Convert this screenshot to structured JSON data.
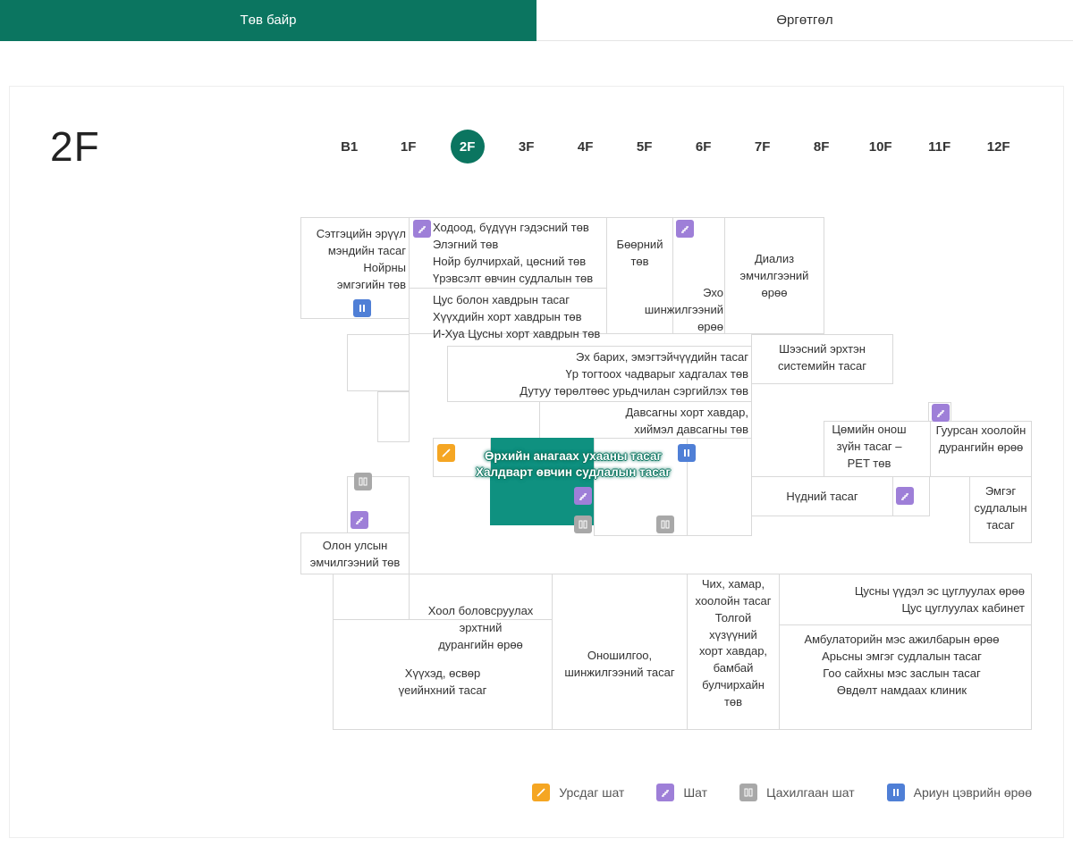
{
  "tabs": {
    "main": "Төв байр",
    "ext": "Өргөтгөл"
  },
  "currentFloorTitle": "2F",
  "floors": [
    "B1",
    "1F",
    "2F",
    "3F",
    "4F",
    "5F",
    "6F",
    "7F",
    "8F",
    "10F",
    "11F",
    "12F"
  ],
  "activeFloor": "2F",
  "rooms": {
    "mental": "Сэтгэцийн эрүүл\nмэндийн тасаг\nНойрны\nэмгэгийн  төв",
    "gi": "Ходоод, бүдүүн гэдэсний төв\nЭлэгний төв\nНойр булчирхай, цөсний төв\nҮрэвсэлт өвчин судлалын төв",
    "blood": "Цус болон хавдрын тасаг\nХүүхдийн хорт хавдрын төв\nИ-Хуа Цусны хорт хавдрын төв",
    "kidney": "Бөөрний\nтөв",
    "echo": "Эхо\nшинжилгээний\nөрөө",
    "dialysis": "Диализ\nэмчилгээний\nөрөө",
    "obgyn": "Эх барих, эмэгтэйчүүдийн тасаг\nҮр тогтоох чадварыг хадгалах төв\nДутуу төрөлтөөс урьдчилан сэргийлэх төв",
    "urology": "Шээсний эрхтэн\nсистемийн тасаг",
    "bladder": "Давсагны хорт хавдар,\nхиймэл давсагны төв",
    "family": "Өрхийн анагаах ухааны тасаг",
    "infection": "Халдварт өвчин судлалын тасаг",
    "pet": "Цөмийн онош\nзүйн тасаг –\nPET төв",
    "broncho": "Гуурсан хоолойн\nдурангийн өрөө",
    "eye": "Нүдний тасаг",
    "patho": "Эмгэг\nсудлалын\nтасаг",
    "intl": "Олон улсын\nэмчилгээний төв",
    "giEndo": "Хоол боловсруулах\nэрхтний\nдурангийн өрөө",
    "diag": "Оношилгоо,\nшинжилгээний тасаг",
    "pediatric": "Хүүхэд, өсвөр\nүеийнхний тасаг",
    "ent": "Чих, хамар,\nхоолойн тасаг\nТолгой\nхүзүүний\nхорт хавдар,\nбамбай\nбулчирхайн\nтөв",
    "stemCell": "Цусны үүдэл эс цуглуулах өрөө\nЦус цуглуулах кабинет",
    "outpatient": "Амбулаторийн мэс ажилбарын өрөө\nАрьсны эмгэг судлалын тасаг\nГоо сайхны мэс заслын тасаг\nӨвдөлт намдаах клиник"
  },
  "legend": {
    "escalator": "Урсдаг шат",
    "stairs": "Шат",
    "elevator": "Цахилгаан шат",
    "restroom": "Ариун цэврийн өрөө"
  },
  "colors": {
    "accent": "#0b7560"
  }
}
